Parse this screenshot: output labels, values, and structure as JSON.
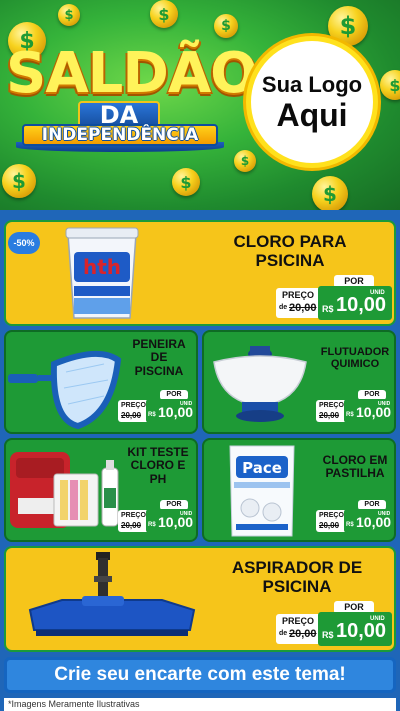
{
  "header": {
    "title_line1": "SALDÃO",
    "title_line2": "DA",
    "title_line3": "INDEPENDÊNCIA",
    "logo_line1": "Sua Logo",
    "logo_line2": "Aqui",
    "coin_icon": "dollar-coin-icon",
    "coin_symbol": "$"
  },
  "badge": {
    "discount": "-50%"
  },
  "price_labels": {
    "preco": "PREÇO",
    "por": "POR",
    "de": "de",
    "currency": "R$",
    "unit": "UNID"
  },
  "products": [
    {
      "name_l1": "CLORO PARA",
      "name_l2": "PSICINA",
      "old_price": "20,00",
      "new_price": "10,00",
      "brand": "hth"
    },
    {
      "name_l1": "PENEIRA",
      "name_l2": "DE",
      "name_l3": "PISCINA",
      "old_price": "20,00",
      "new_price": "10,00"
    },
    {
      "name_l1": "FLUTUADOR",
      "name_l2": "QUIMICO",
      "old_price": "20,00",
      "new_price": "10,00"
    },
    {
      "name_l1": "KIT TESTE",
      "name_l2": "CLORO E",
      "name_l3": "PH",
      "old_price": "20,00",
      "new_price": "10,00"
    },
    {
      "name_l1": "CLORO EM",
      "name_l2": "PASTILHA",
      "old_price": "20,00",
      "new_price": "10,00",
      "brand": "Pace"
    },
    {
      "name_l1": "ASPIRADOR DE",
      "name_l2": "PSICINA",
      "old_price": "20,00",
      "new_price": "10,00"
    }
  ],
  "cta": {
    "label": "Crie seu encarte com este tema!"
  },
  "footnote": {
    "text": "*Imagens Meramente Ilustrativas"
  },
  "colors": {
    "green": "#1e9a36",
    "yellow": "#f6c51a",
    "blue": "#1f66b8"
  }
}
